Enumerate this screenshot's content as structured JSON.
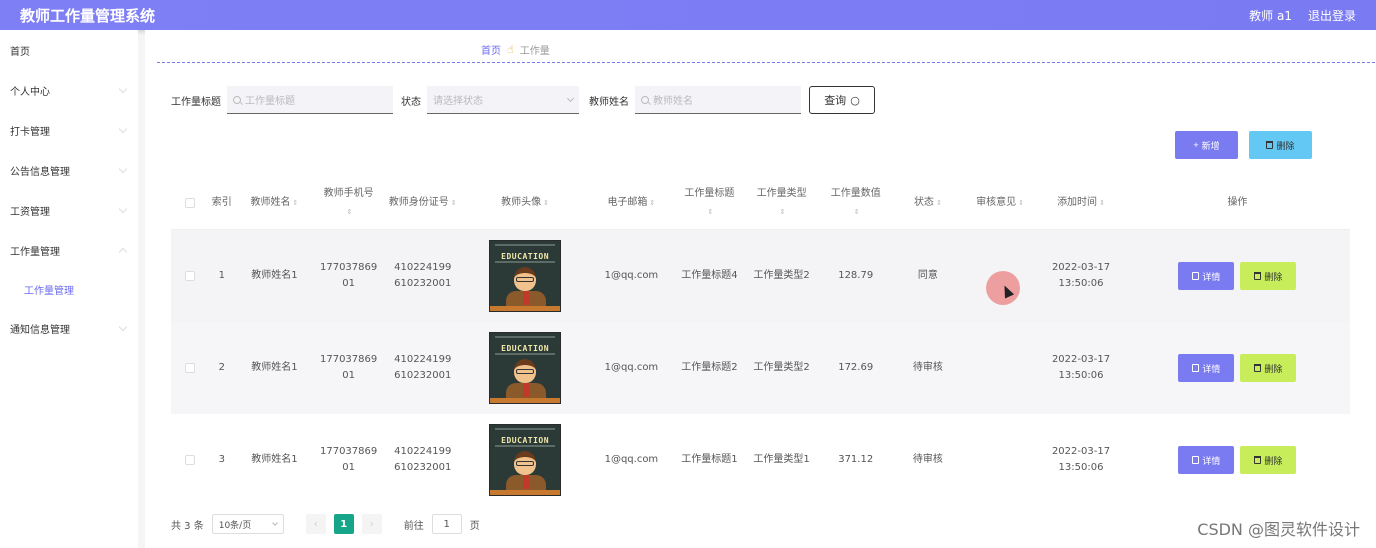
{
  "header": {
    "title": "教师工作量管理系统",
    "user": "教师 a1",
    "logout": "退出登录"
  },
  "sidebar": {
    "items": [
      {
        "label": "首页"
      },
      {
        "label": "个人中心"
      },
      {
        "label": "打卡管理"
      },
      {
        "label": "公告信息管理"
      },
      {
        "label": "工资管理"
      },
      {
        "label": "工作量管理"
      },
      {
        "label": "工作量管理"
      },
      {
        "label": "通知信息管理"
      }
    ]
  },
  "breadcrumb": {
    "home": "首页",
    "current": "工作量"
  },
  "search": {
    "title_label": "工作量标题",
    "title_placeholder": "工作量标题",
    "status_label": "状态",
    "status_placeholder": "请选择状态",
    "teacher_label": "教师姓名",
    "teacher_placeholder": "教师姓名",
    "query_button": "查询"
  },
  "actions": {
    "add": "新增",
    "delete": "删除"
  },
  "table": {
    "headers": {
      "index": "索引",
      "teacher_name": "教师姓名",
      "phone": "教师手机号",
      "id_card": "教师身份证号",
      "avatar": "教师头像",
      "email": "电子邮箱",
      "work_title": "工作量标题",
      "work_type": "工作量类型",
      "work_value": "工作量数值",
      "status": "状态",
      "review": "审核意见",
      "add_time": "添加时间",
      "ops": "操作"
    },
    "avatar_text": "EDUCATION",
    "rows": [
      {
        "index": "1",
        "teacher_name": "教师姓名1",
        "phone_a": "177037869",
        "phone_b": "01",
        "id_a": "410224199",
        "id_b": "610232001",
        "email": "1@qq.com",
        "work_title": "工作量标题4",
        "work_type": "工作量类型2",
        "work_value": "128.79",
        "status": "同意",
        "review": "",
        "date": "2022-03-17",
        "time": "13:50:06"
      },
      {
        "index": "2",
        "teacher_name": "教师姓名1",
        "phone_a": "177037869",
        "phone_b": "01",
        "id_a": "410224199",
        "id_b": "610232001",
        "email": "1@qq.com",
        "work_title": "工作量标题2",
        "work_type": "工作量类型2",
        "work_value": "172.69",
        "status": "待审核",
        "review": "",
        "date": "2022-03-17",
        "time": "13:50:06"
      },
      {
        "index": "3",
        "teacher_name": "教师姓名1",
        "phone_a": "177037869",
        "phone_b": "01",
        "id_a": "410224199",
        "id_b": "610232001",
        "email": "1@qq.com",
        "work_title": "工作量标题1",
        "work_type": "工作量类型1",
        "work_value": "371.12",
        "status": "待审核",
        "review": "",
        "date": "2022-03-17",
        "time": "13:50:06"
      }
    ],
    "row_actions": {
      "detail": "详情",
      "delete": "删除"
    }
  },
  "pager": {
    "total": "共 3 条",
    "page_size": "10条/页",
    "current": "1",
    "goto_label": "前往",
    "goto_value": "1",
    "page_unit": "页"
  },
  "watermark": "CSDN @图灵软件设计",
  "colors": {
    "primary": "#7b7bf1",
    "info": "#63c8f4",
    "lime": "#c7ee5a",
    "pager_active": "#17a589"
  }
}
